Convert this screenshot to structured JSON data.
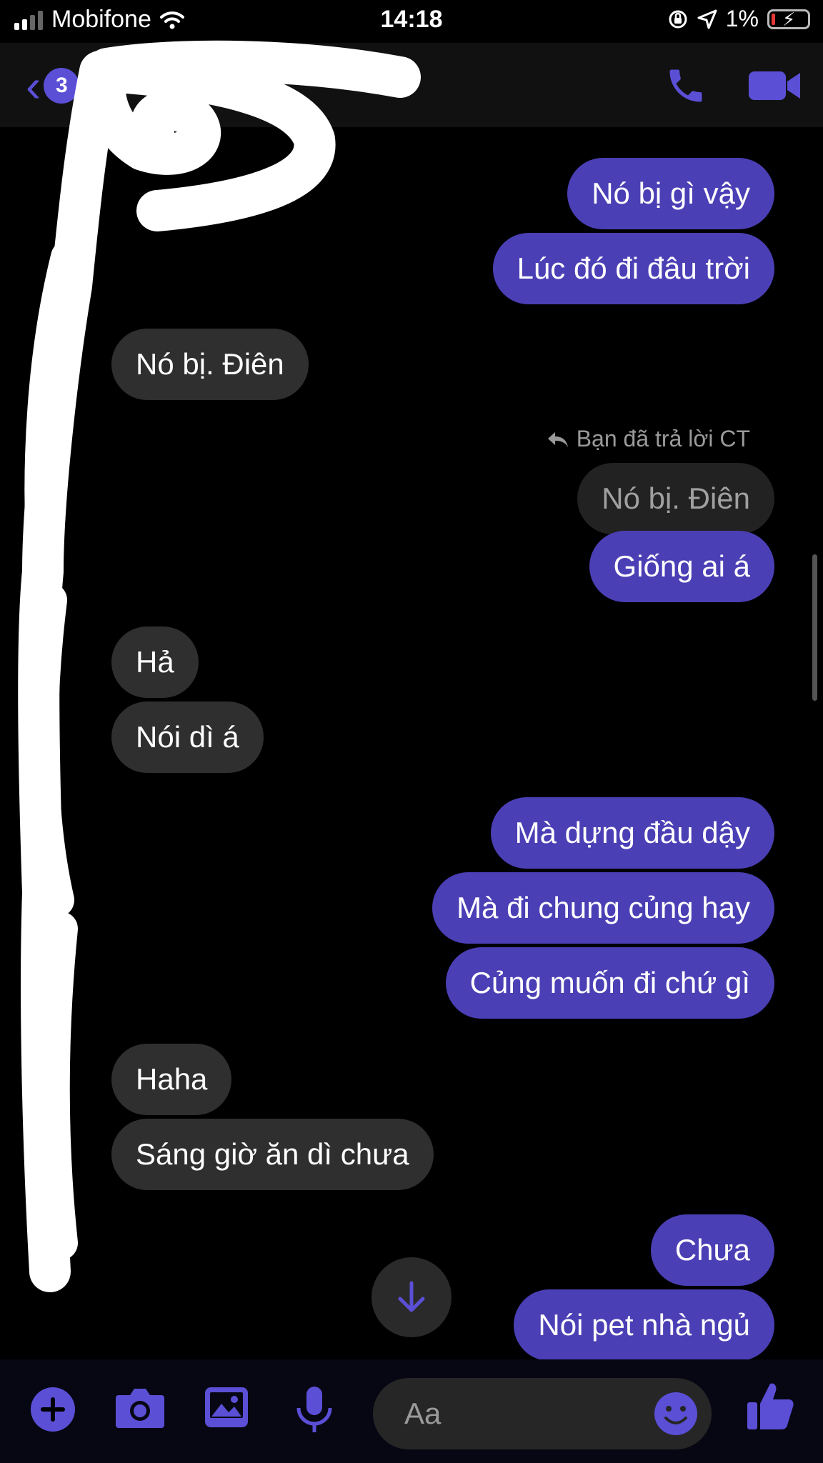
{
  "status_bar": {
    "carrier": "Mobifone",
    "time": "14:18",
    "battery_percent": "1%"
  },
  "header": {
    "back_badge": "3"
  },
  "messages": [
    {
      "side": "me",
      "text": "Nó bị gì vậy"
    },
    {
      "side": "me",
      "text": "Lúc đó đi đâu trời"
    },
    {
      "side": "them",
      "text": "Nó bị. Điên"
    },
    {
      "side": "me",
      "text": "Giống ai á",
      "reply_note": "Bạn đã trả lời CT",
      "quoted": "Nó bị. Điên"
    },
    {
      "side": "them",
      "text": "Hả"
    },
    {
      "side": "them",
      "text": "Nói dì á"
    },
    {
      "side": "me",
      "text": "Mà dựng đầu dậy"
    },
    {
      "side": "me",
      "text": "Mà đi chung củng hay"
    },
    {
      "side": "me",
      "text": "Củng muốn đi chứ gì"
    },
    {
      "side": "them",
      "text": "Haha"
    },
    {
      "side": "them",
      "text": "Sáng giờ ăn dì chưa"
    },
    {
      "side": "me",
      "text": "Chưa"
    },
    {
      "side": "me",
      "text": "Nói pet nhà ngủ"
    }
  ],
  "composer": {
    "placeholder": "Aa"
  },
  "colors": {
    "accent": "#5b4fd6",
    "my_bubble": "#4b3fb5",
    "their_bubble": "#2f2f2f",
    "background": "#000000"
  },
  "icons": [
    "signal-icon",
    "wifi-icon",
    "orientation-lock-icon",
    "location-icon",
    "battery-icon",
    "back-chevron-icon",
    "phone-icon",
    "video-camera-icon",
    "reply-arrow-icon",
    "arrow-down-icon",
    "plus-icon",
    "camera-icon",
    "image-icon",
    "microphone-icon",
    "emoji-icon",
    "thumbs-up-icon"
  ]
}
